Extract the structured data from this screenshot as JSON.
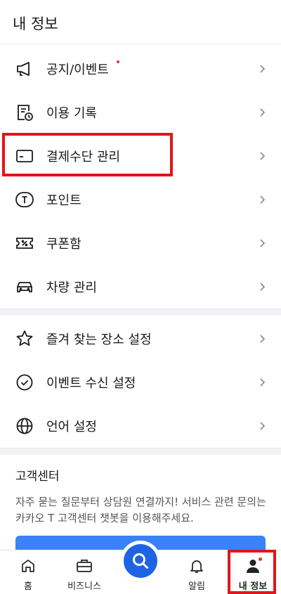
{
  "header": {
    "title": "내 정보"
  },
  "menu": [
    {
      "label": "공지/이벤트",
      "icon": "megaphone-icon",
      "has_dot": true
    },
    {
      "label": "이용 기록",
      "icon": "history-icon"
    },
    {
      "label": "결제수단 관리",
      "icon": "card-icon"
    },
    {
      "label": "포인트",
      "icon": "point-icon"
    },
    {
      "label": "쿠폰함",
      "icon": "coupon-icon"
    },
    {
      "label": "차량 관리",
      "icon": "car-icon"
    },
    {
      "label": "즐겨 찾는 장소 설정",
      "icon": "star-icon"
    },
    {
      "label": "이벤트 수신 설정",
      "icon": "check-circle-icon"
    },
    {
      "label": "언어 설정",
      "icon": "globe-icon"
    }
  ],
  "customer_center": {
    "title": "고객센터",
    "description": "자주 묻는 질문부터 상담원 연결까지! 서비스 관련 문의는 카카오 T 고객센터 챗봇을 이용해주세요."
  },
  "tabbar": {
    "home": "홈",
    "business": "비즈니스",
    "alerts": "알림",
    "my_info": "내 정보"
  },
  "colors": {
    "highlight": "#e4141b",
    "accent": "#1e63e4",
    "button": "#3a82f7",
    "dot": "#e53030"
  }
}
